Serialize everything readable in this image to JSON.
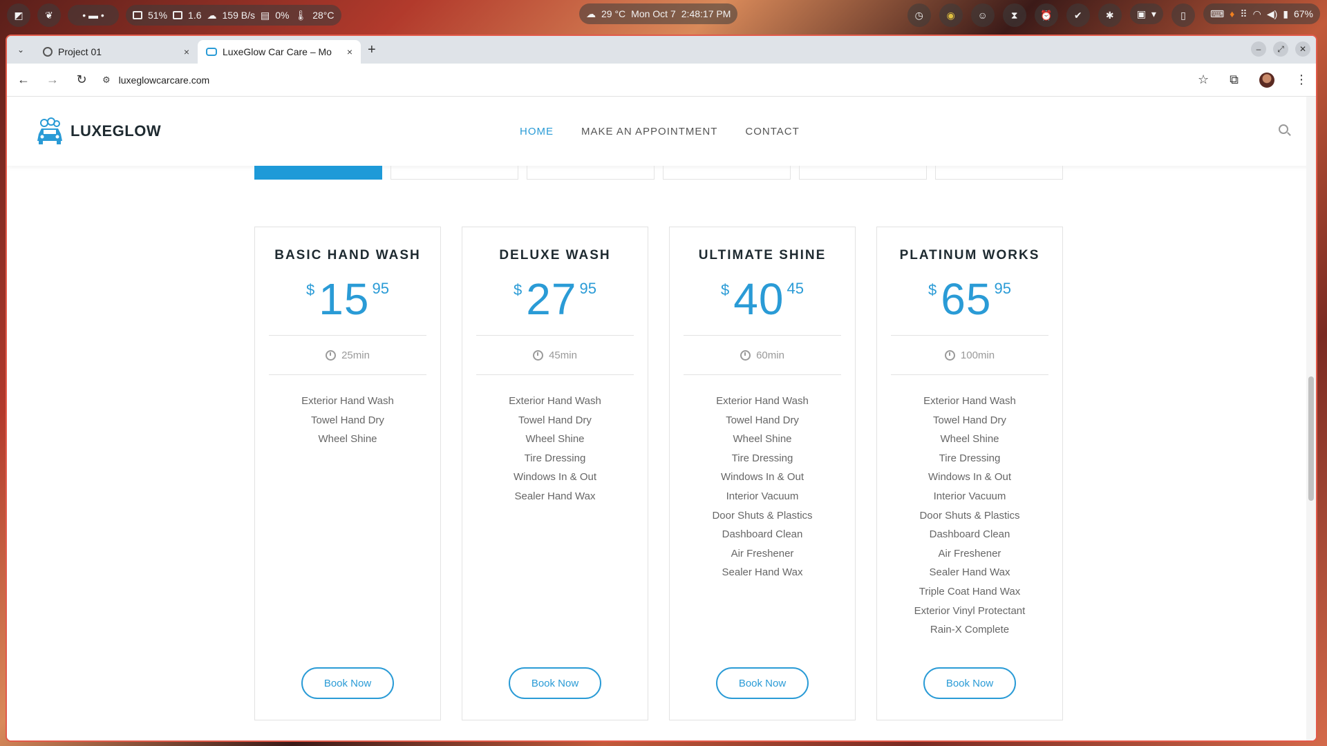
{
  "system": {
    "cpu": "51%",
    "load": "1.6",
    "net": "159 B/s",
    "disk": "0%",
    "temp": "28°C",
    "weather": "29 °C",
    "date": "Mon Oct 7",
    "time": "2:48:17 PM",
    "battery": "67%"
  },
  "browser": {
    "tabs": [
      {
        "label": "Project 01",
        "close": "×"
      },
      {
        "label": "LuxeGlow Car Care – Mo",
        "close": "×"
      }
    ],
    "new_tab": "+",
    "url": "luxeglowcarcare.com"
  },
  "site": {
    "brand": "LUXEGLOW",
    "nav": [
      "HOME",
      "MAKE AN APPOINTMENT",
      "CONTACT"
    ],
    "accent": "#2a9bd6"
  },
  "plans": [
    {
      "title": "BASIC HAND WASH",
      "currency": "$",
      "whole": "15",
      "cents": "95",
      "duration": "25min",
      "features": [
        "Exterior Hand Wash",
        "Towel Hand Dry",
        "Wheel Shine"
      ],
      "button": "Book Now"
    },
    {
      "title": "DELUXE WASH",
      "currency": "$",
      "whole": "27",
      "cents": "95",
      "duration": "45min",
      "features": [
        "Exterior Hand Wash",
        "Towel Hand Dry",
        "Wheel Shine",
        "Tire Dressing",
        "Windows In & Out",
        "Sealer Hand Wax"
      ],
      "button": "Book Now"
    },
    {
      "title": "ULTIMATE SHINE",
      "currency": "$",
      "whole": "40",
      "cents": "45",
      "duration": "60min",
      "features": [
        "Exterior Hand Wash",
        "Towel Hand Dry",
        "Wheel Shine",
        "Tire Dressing",
        "Windows In & Out",
        "Interior Vacuum",
        "Door Shuts & Plastics",
        "Dashboard Clean",
        "Air Freshener",
        "Sealer Hand Wax"
      ],
      "button": "Book Now"
    },
    {
      "title": "PLATINUM WORKS",
      "currency": "$",
      "whole": "65",
      "cents": "95",
      "duration": "100min",
      "features": [
        "Exterior Hand Wash",
        "Towel Hand Dry",
        "Wheel Shine",
        "Tire Dressing",
        "Windows In & Out",
        "Interior Vacuum",
        "Door Shuts & Plastics",
        "Dashboard Clean",
        "Air Freshener",
        "Sealer Hand Wax",
        "Triple Coat Hand Wax",
        "Exterior Vinyl Protectant",
        "Rain-X Complete"
      ],
      "button": "Book Now"
    }
  ]
}
